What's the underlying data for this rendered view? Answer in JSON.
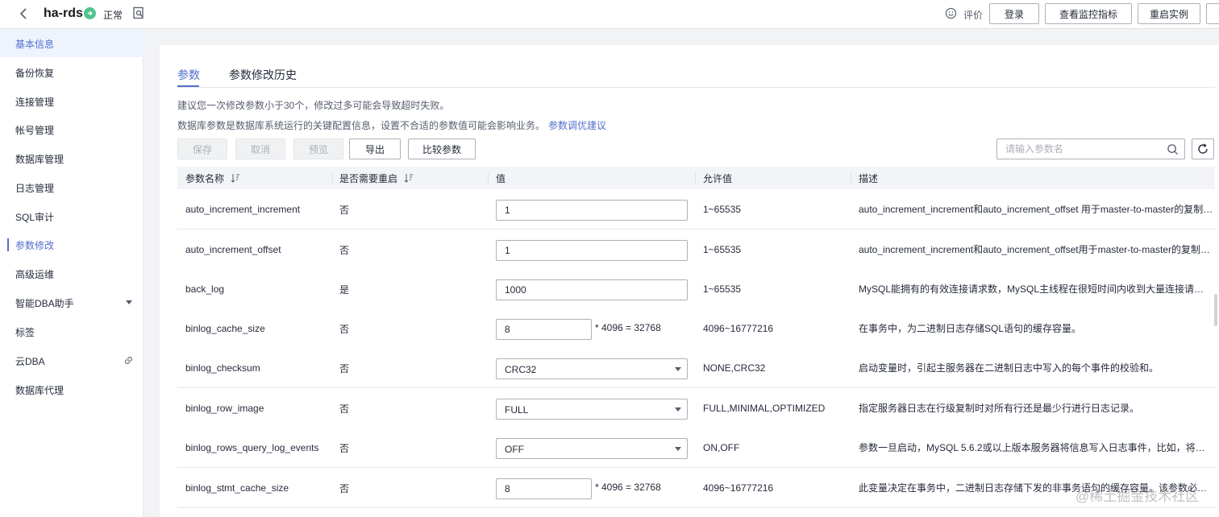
{
  "header": {
    "instance_name": "ha-rds",
    "status": "正常",
    "rate_label": "评价",
    "buttons": {
      "login": "登录",
      "monitor": "查看监控指标",
      "restart": "重启实例"
    }
  },
  "sidebar": {
    "items": [
      {
        "label": "基本信息"
      },
      {
        "label": "备份恢复"
      },
      {
        "label": "连接管理"
      },
      {
        "label": "帐号管理"
      },
      {
        "label": "数据库管理"
      },
      {
        "label": "日志管理"
      },
      {
        "label": "SQL审计"
      },
      {
        "label": "参数修改"
      },
      {
        "label": "高级运维"
      },
      {
        "label": "智能DBA助手"
      },
      {
        "label": "标签"
      },
      {
        "label": "云DBA"
      },
      {
        "label": "数据库代理"
      }
    ]
  },
  "main": {
    "tabs": [
      {
        "label": "参数"
      },
      {
        "label": "参数修改历史"
      }
    ],
    "tip1": "建议您一次修改参数小于30个，修改过多可能会导致超时失败。",
    "tip2": "数据库参数是数据库系统运行的关键配置信息，设置不合适的参数值可能会影响业务。",
    "tip2_link": "参数调优建议",
    "toolbar": {
      "save": "保存",
      "cancel": "取消",
      "preview": "预览",
      "export": "导出",
      "compare": "比较参数"
    },
    "search": {
      "placeholder": "请输入参数名"
    },
    "table": {
      "headers": {
        "name": "参数名称",
        "restart": "是否需要重启",
        "value": "值",
        "allowed": "允许值",
        "desc": "描述"
      },
      "rows": [
        {
          "name": "auto_increment_increment",
          "restart": "否",
          "value": "1",
          "allowed": "1~65535",
          "desc": "auto_increment_increment和auto_increment_offset 用于master-to-master的复制，..."
        },
        {
          "name": "auto_increment_offset",
          "restart": "否",
          "value": "1",
          "allowed": "1~65535",
          "desc": "auto_increment_increment和auto_increment_offset用于master-to-master的复制，..."
        },
        {
          "name": "back_log",
          "restart": "是",
          "value": "1000",
          "allowed": "1~65535",
          "desc": "MySQL能拥有的有效连接请求数，MySQL主线程在很短时间内收到大量连接请求时发..."
        },
        {
          "name": "binlog_cache_size",
          "restart": "否",
          "value": "8",
          "formula": "* 4096 = 32768",
          "allowed": "4096~16777216",
          "desc": "在事务中，为二进制日志存储SQL语句的缓存容量。"
        },
        {
          "name": "binlog_checksum",
          "restart": "否",
          "value": "CRC32",
          "allowed": "NONE,CRC32",
          "desc": "启动变量时，引起主服务器在二进制日志中写入的每个事件的校验和。"
        },
        {
          "name": "binlog_row_image",
          "restart": "否",
          "value": "FULL",
          "allowed": "FULL,MINIMAL,OPTIMIZED",
          "desc": "指定服务器日志在行级复制时对所有行还是最少行进行日志记录。"
        },
        {
          "name": "binlog_rows_query_log_events",
          "restart": "否",
          "value": "OFF",
          "allowed": "ON,OFF",
          "desc": "参数一旦启动，MySQL 5.6.2或以上版本服务器将信息写入日志事件，比如，将行日..."
        },
        {
          "name": "binlog_stmt_cache_size",
          "restart": "否",
          "value": "8",
          "formula": "* 4096 = 32768",
          "allowed": "4096~16777216",
          "desc": "此变量决定在事务中，二进制日志存储下发的非事务语句的缓存容量。该参数必须是..."
        }
      ]
    }
  },
  "watermark": "@稀土掘金技术社区",
  "colors": {
    "accent": "#526ecc",
    "status_green": "#50c48f"
  }
}
